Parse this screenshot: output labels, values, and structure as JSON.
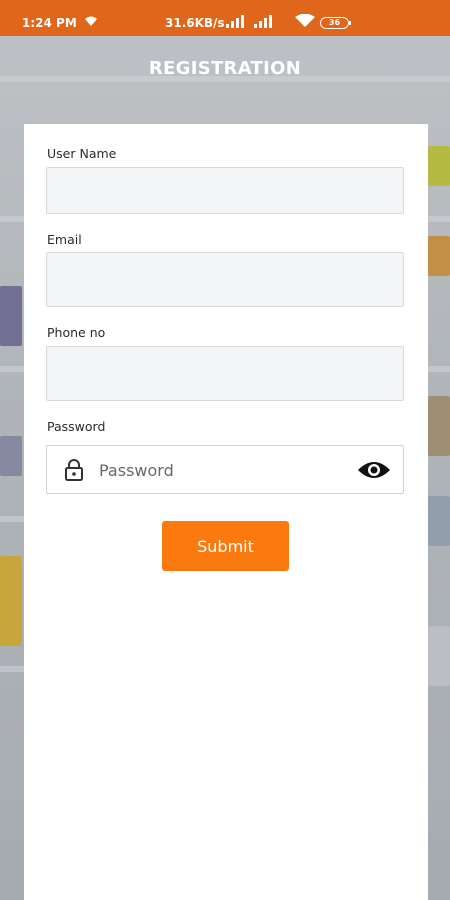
{
  "status_bar": {
    "time": "1:24 PM",
    "net_speed": "31.6KB/s",
    "battery": "36"
  },
  "header": {
    "title": "REGISTRATION"
  },
  "form": {
    "username_label": "User Name",
    "email_label": "Email",
    "phone_label": "Phone no",
    "password_label": "Password",
    "password_placeholder": "Password",
    "submit_label": "Submit"
  },
  "colors": {
    "status_bar": "#e0661b",
    "accent": "#fa7a10"
  },
  "icons": {
    "password_left": "lock-icon",
    "password_right": "eye-icon"
  }
}
